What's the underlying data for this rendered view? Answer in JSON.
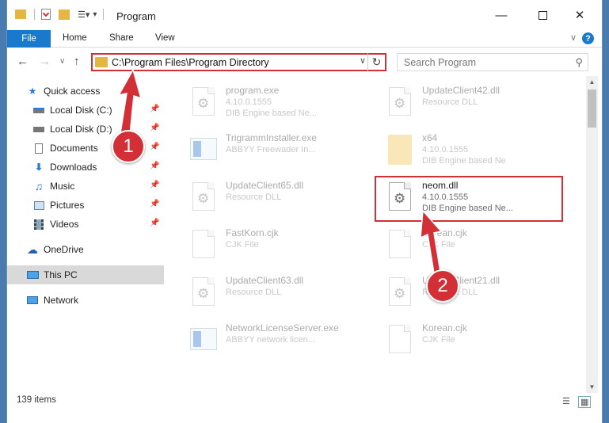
{
  "window": {
    "title": "Program"
  },
  "ribbon": {
    "tabs": [
      "File",
      "Home",
      "Share",
      "View"
    ],
    "help": "?"
  },
  "nav": {
    "address": "C:\\Program Files\\Program Directory",
    "search_placeholder": "Search Program"
  },
  "sidebar": {
    "items": [
      {
        "label": "Quick access",
        "icon": "star-icon"
      },
      {
        "label": "Local Disk (C:)",
        "icon": "drive-icon",
        "pinned": true
      },
      {
        "label": "Local Disk (D:)",
        "icon": "drive-icon",
        "pinned": true
      },
      {
        "label": "Documents",
        "icon": "documents-icon",
        "pinned": true
      },
      {
        "label": "Downloads",
        "icon": "download-icon",
        "pinned": true
      },
      {
        "label": "Music",
        "icon": "music-icon",
        "pinned": true
      },
      {
        "label": "Pictures",
        "icon": "pictures-icon",
        "pinned": true
      },
      {
        "label": "Videos",
        "icon": "videos-icon",
        "pinned": true
      },
      {
        "label": "OneDrive",
        "icon": "cloud-icon"
      },
      {
        "label": "This PC",
        "icon": "computer-icon",
        "selected": true
      },
      {
        "label": "Network",
        "icon": "network-icon"
      }
    ]
  },
  "files": [
    {
      "name": "program.exe",
      "line2": "4.10.0.1555",
      "line3": "DIB Engine based Ne...",
      "icon": "app-icon"
    },
    {
      "name": "UpdateClient42.dll",
      "line2": "Resource DLL",
      "line3": "",
      "icon": "dll-icon"
    },
    {
      "name": "TrigrammInstaller.exe",
      "line2": "ABBYY Freewader In...",
      "line3": "",
      "icon": "app-icon"
    },
    {
      "name": "x64",
      "line2": "4.10.0.1555",
      "line3": "DIB Engine based Ne",
      "icon": "folder-icon"
    },
    {
      "name": "UpdateClient65.dll",
      "line2": "Resource DLL",
      "line3": "",
      "icon": "dll-icon"
    },
    {
      "name": "neom.dll",
      "line2": "4.10.0.1555",
      "line3": "DIB Engine based Ne...",
      "icon": "dll-icon",
      "highlighted": true
    },
    {
      "name": "FastKorn.cjk",
      "line2": "CJK File",
      "line3": "",
      "icon": "file-icon"
    },
    {
      "name": "Korean.cjk",
      "line2": "CJK File",
      "line3": "",
      "icon": "file-icon"
    },
    {
      "name": "UpdateClient63.dll",
      "line2": "Resource DLL",
      "line3": "",
      "icon": "dll-icon"
    },
    {
      "name": "UpdateClient21.dll",
      "line2": "Resource DLL",
      "line3": "",
      "icon": "dll-icon"
    },
    {
      "name": "NetworkLicenseServer.exe",
      "line2": "ABBYY network licen...",
      "line3": "",
      "icon": "app-icon"
    },
    {
      "name": "Korean.cjk",
      "line2": "CJK File",
      "line3": "",
      "icon": "file-icon"
    }
  ],
  "status": {
    "count": "139 items"
  },
  "annotations": {
    "step1": "1",
    "step2": "2",
    "color": "#d22f36"
  }
}
